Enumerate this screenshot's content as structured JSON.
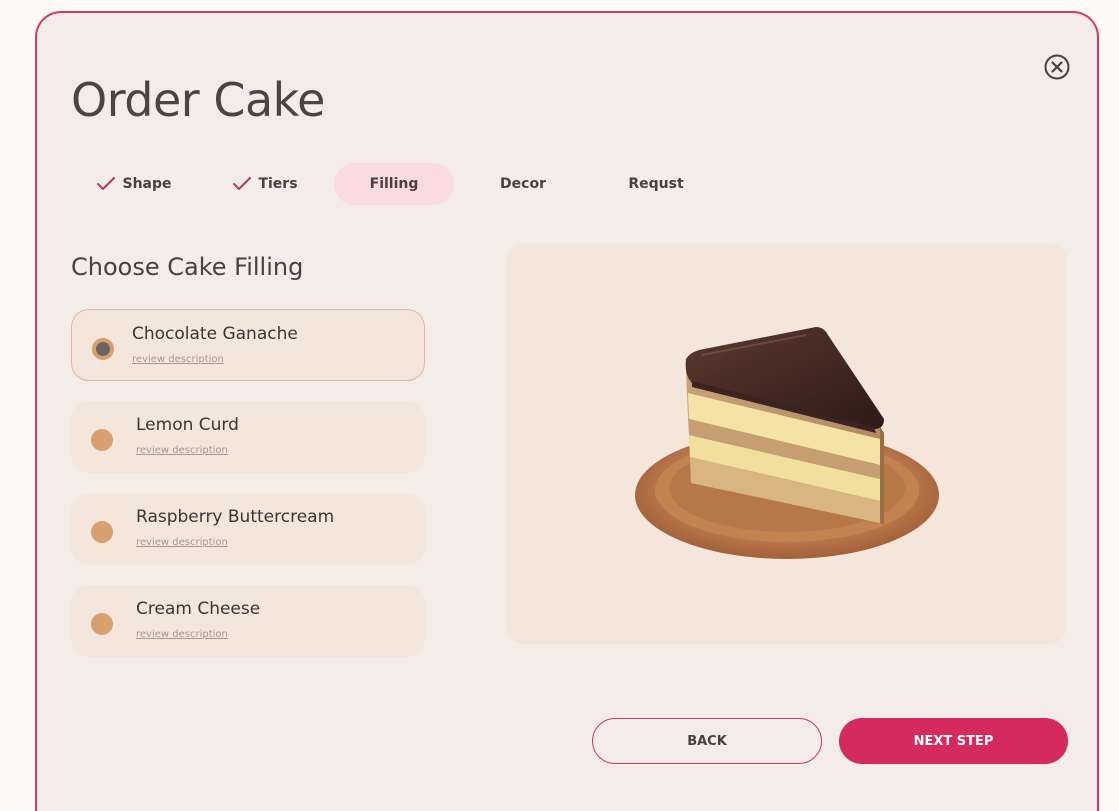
{
  "header": {
    "title": "Order Cake"
  },
  "steps": [
    {
      "label": "Shape",
      "completed": true,
      "active": false
    },
    {
      "label": "Tiers",
      "completed": true,
      "active": false
    },
    {
      "label": "Filling",
      "completed": false,
      "active": true
    },
    {
      "label": "Decor",
      "completed": false,
      "active": false
    },
    {
      "label": "Requst",
      "completed": false,
      "active": false
    }
  ],
  "filling": {
    "heading": "Choose Cake Filling",
    "options": [
      {
        "name": "Chocolate Ganache",
        "link": "review description",
        "selected": true
      },
      {
        "name": "Lemon Curd",
        "link": "review description",
        "selected": false
      },
      {
        "name": "Raspberry Buttercream",
        "link": "review description",
        "selected": false
      },
      {
        "name": "Cream Cheese",
        "link": "review description",
        "selected": false
      }
    ]
  },
  "buttons": {
    "back": "BACK",
    "next": "NEXT STEP"
  },
  "colors": {
    "accent": "#d42a5e",
    "border": "#d43a68",
    "panel": "#f5e6db",
    "radio": "#d9a06f",
    "active_tab": "#fadbe2"
  },
  "icons": {
    "close": "close-circle-icon",
    "check": "check-icon"
  }
}
